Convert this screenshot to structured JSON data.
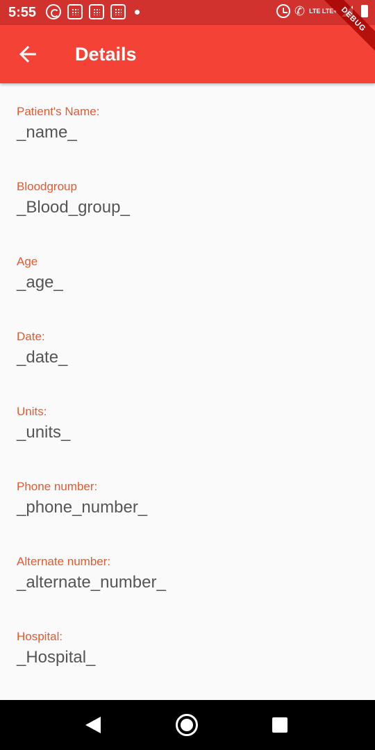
{
  "status_bar": {
    "time": "5:55",
    "network_label": "LTE LTE+"
  },
  "debug_banner": "DEBUG",
  "app_bar": {
    "title": "Details",
    "back_icon": "arrow-back-icon"
  },
  "fields": [
    {
      "label": "Patient's Name:",
      "value": "_name_"
    },
    {
      "label": "Bloodgroup",
      "value": "_Blood_group_"
    },
    {
      "label": "Age",
      "value": "_age_"
    },
    {
      "label": "Date:",
      "value": "_date_"
    },
    {
      "label": "Units:",
      "value": "_units_"
    },
    {
      "label": "Phone number:",
      "value": "_phone_number_"
    },
    {
      "label": "Alternate number:",
      "value": "_alternate_number_"
    },
    {
      "label": "Hospital:",
      "value": "_Hospital_"
    }
  ],
  "colors": {
    "status_bar": "#d2322d",
    "app_bar": "#f44336",
    "label": "#e8582c",
    "value": "#555555"
  }
}
